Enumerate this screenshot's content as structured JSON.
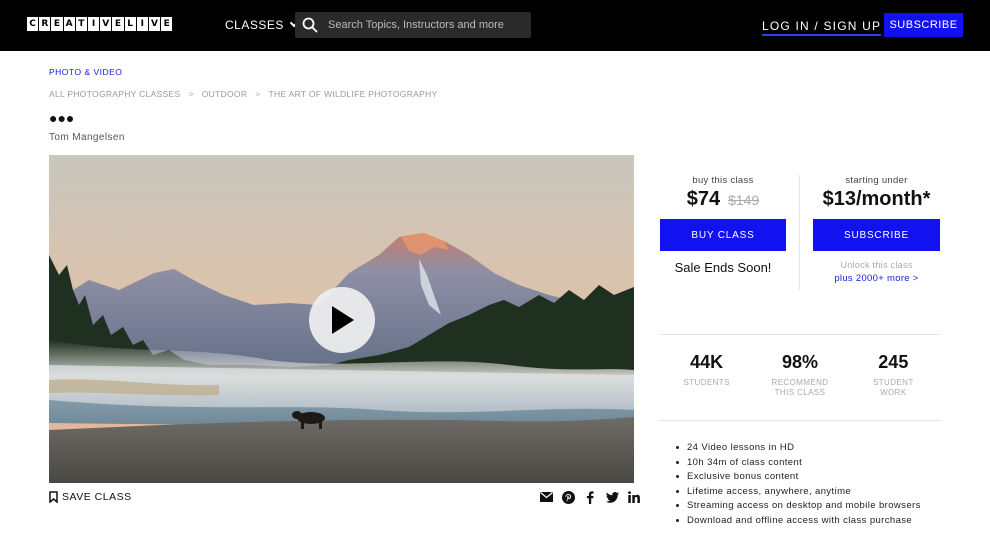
{
  "header": {
    "logo_letters": [
      "C",
      "R",
      "E",
      "A",
      "T",
      "I",
      "V",
      "E",
      "L",
      "I",
      "V",
      "E"
    ],
    "classes_label": "CLASSES",
    "search_placeholder": "Search Topics, Instructors and more",
    "login_label": "LOG IN / SIGN UP",
    "subscribe_label": "SUBSCRIBE"
  },
  "course": {
    "category": "PHOTO & VIDEO",
    "breadcrumb": [
      "ALL PHOTOGRAPHY CLASSES",
      "OUTDOOR",
      "THE ART OF WILDLIFE PHOTOGRAPHY"
    ],
    "breadcrumb_sep": ">",
    "title_placeholder": "●●●",
    "instructor": "Tom Mangelsen",
    "save_label": "SAVE CLASS"
  },
  "share_icons": [
    "email-icon",
    "pinterest-icon",
    "facebook-icon",
    "twitter-icon",
    "linkedin-icon"
  ],
  "purchase": {
    "buy_label": "buy this class",
    "price": "$74",
    "old_price": "$149",
    "buy_button": "BUY CLASS",
    "sale_text": "Sale Ends Soon!",
    "sub_label": "starting under",
    "sub_price": "$13/month*",
    "sub_button": "SUBSCRIBE",
    "unlock_text": "Unlock this class",
    "more_link": "plus 2000+ more >"
  },
  "stats": [
    {
      "value": "44K",
      "label": "STUDENTS"
    },
    {
      "value": "98%",
      "label": "RECOMMEND THIS CLASS"
    },
    {
      "value": "245",
      "label": "STUDENT WORK"
    }
  ],
  "features": [
    "24 Video lessons in HD",
    "10h 34m of class content",
    "Exclusive bonus content",
    "Lifetime access, anywhere, anytime",
    "Streaming access on desktop and mobile browsers",
    "Download and offline access with class purchase"
  ],
  "colors": {
    "accent": "#1212f0",
    "link": "#1a22d8",
    "topbar": "#000000"
  }
}
